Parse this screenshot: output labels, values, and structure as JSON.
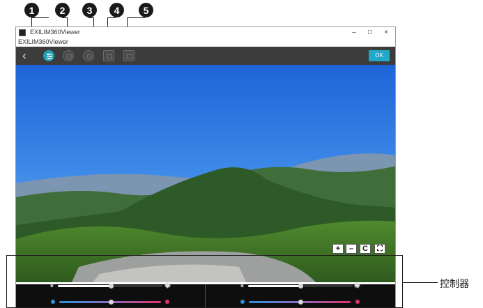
{
  "callouts": [
    "1",
    "2",
    "3",
    "4",
    "5"
  ],
  "window": {
    "title": "EXILIM360Viewer",
    "app_name": "EXILIM360Viewer",
    "minimize": "–",
    "maximize": "□",
    "close": "×"
  },
  "toolbar": {
    "back": "‹",
    "ok_label": "OK",
    "tools": [
      "adjust-icon",
      "tool2-icon",
      "tool3-icon",
      "tool4-icon",
      "tool5-icon"
    ]
  },
  "zoom_buttons": {
    "zoom_in": "+",
    "zoom_out": "–",
    "reset": "C",
    "fullscreen": "⛶"
  },
  "controller": {
    "label": "控制器",
    "left": {
      "brightness": 0.4,
      "color_balance": 0.5
    },
    "right": {
      "brightness": 0.4,
      "color_balance": 0.5
    }
  },
  "colors": {
    "accent": "#22a8c8",
    "active_tool": "#1fa3b3",
    "cool_dot": "#2c8fe0",
    "warm_dot": "#e0336b"
  }
}
